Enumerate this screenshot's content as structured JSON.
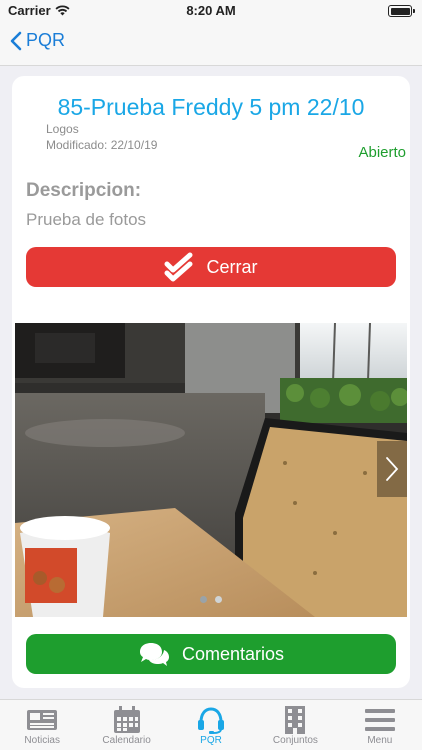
{
  "status_bar": {
    "carrier": "Carrier",
    "time": "8:20 AM"
  },
  "nav": {
    "back_label": "PQR"
  },
  "pqr": {
    "title": "85-Prueba Freddy 5 pm 22/10",
    "category": "Logos",
    "modified": "Modificado: 22/10/19",
    "status": "Abierto",
    "description_label": "Descripcion:",
    "description": "Prueba de fotos",
    "close_label": "Cerrar",
    "comments_label": "Comentarios"
  },
  "gallery": {
    "current": 1,
    "total": 2
  },
  "tabs": [
    {
      "label": "Noticias",
      "icon": "newspaper-icon",
      "active": false
    },
    {
      "label": "Calendario",
      "icon": "calendar-icon",
      "active": false
    },
    {
      "label": "PQR",
      "icon": "headset-icon",
      "active": true
    },
    {
      "label": "Conjuntos",
      "icon": "building-icon",
      "active": false
    },
    {
      "label": "Menu",
      "icon": "menu-icon",
      "active": false
    }
  ],
  "colors": {
    "accent": "#1aa7e6",
    "close": "#e53935",
    "open": "#1e9e2e",
    "link": "#1a7dd7"
  }
}
